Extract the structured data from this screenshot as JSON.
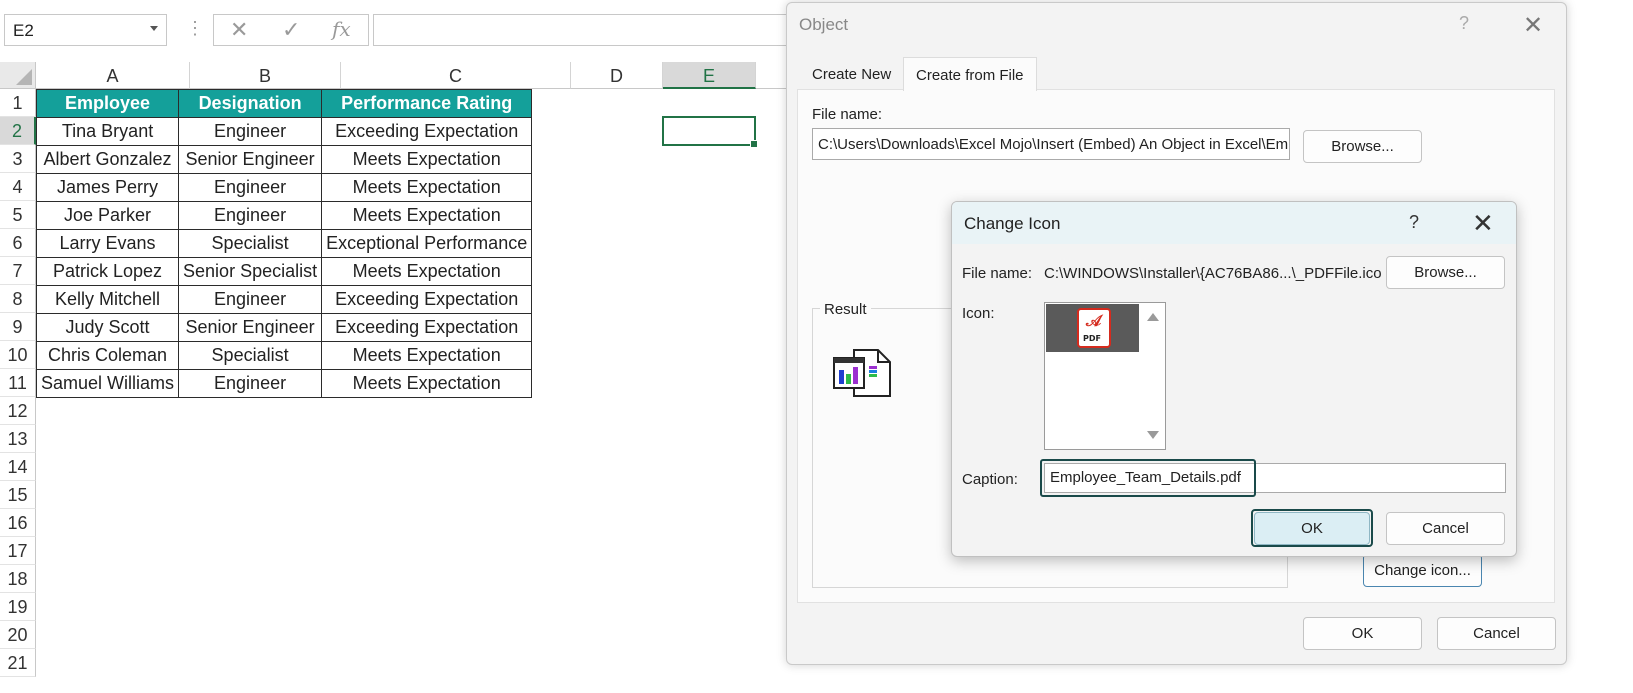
{
  "formula_bar": {
    "name_box": "E2",
    "cancel_symbol": "✕",
    "enter_symbol": "✓",
    "fx_symbol": "fx",
    "formula": ""
  },
  "grid": {
    "columns": [
      "A",
      "B",
      "C",
      "D",
      "E"
    ],
    "rows": [
      "1",
      "2",
      "3",
      "4",
      "5",
      "6",
      "7",
      "8",
      "9",
      "10",
      "11",
      "12",
      "13",
      "14",
      "15",
      "16",
      "17",
      "18",
      "19",
      "20",
      "21"
    ],
    "header_color": "#14A09A",
    "selection_color": "#217346",
    "headers": [
      "Employee",
      "Designation",
      "Performance Rating"
    ],
    "data": [
      [
        "Tina Bryant",
        "Engineer",
        "Exceeding Expectation"
      ],
      [
        "Albert Gonzalez",
        "Senior Engineer",
        "Meets Expectation"
      ],
      [
        "James Perry",
        "Engineer",
        "Meets Expectation"
      ],
      [
        "Joe Parker",
        "Engineer",
        "Meets Expectation"
      ],
      [
        "Larry Evans",
        "Specialist",
        "Exceptional Performance"
      ],
      [
        "Patrick Lopez",
        "Senior Specialist",
        "Meets Expectation"
      ],
      [
        "Kelly Mitchell",
        "Engineer",
        "Exceeding Expectation"
      ],
      [
        "Judy Scott",
        "Senior Engineer",
        "Exceeding Expectation"
      ],
      [
        "Chris Coleman",
        "Specialist",
        "Meets Expectation"
      ],
      [
        "Samuel Williams",
        "Engineer",
        "Meets Expectation"
      ]
    ]
  },
  "object_dialog": {
    "title": "Object",
    "help": "?",
    "close": "✕",
    "tabs": [
      "Create New",
      "Create from File"
    ],
    "file_name_label": "File name:",
    "file_name_value": "C:\\Users\\Downloads\\Excel Mojo\\Insert (Embed) An Object in Excel\\Employee",
    "browse": "Browse...",
    "result_label": "Result",
    "change_icon": "Change icon...",
    "ok": "OK",
    "cancel": "Cancel"
  },
  "change_icon_dialog": {
    "title": "Change Icon",
    "help": "?",
    "close": "✕",
    "file_name_label": "File name:",
    "file_name_value": "C:\\WINDOWS\\Installer\\{AC76BA86...\\_PDFFile.ico",
    "browse": "Browse...",
    "icon_label": "Icon:",
    "icon_name": "pdf-file-icon",
    "pdf_text": "PDF",
    "caption_label": "Caption:",
    "caption_value": "Employee_Team_Details.pdf",
    "ok": "OK",
    "cancel": "Cancel"
  }
}
